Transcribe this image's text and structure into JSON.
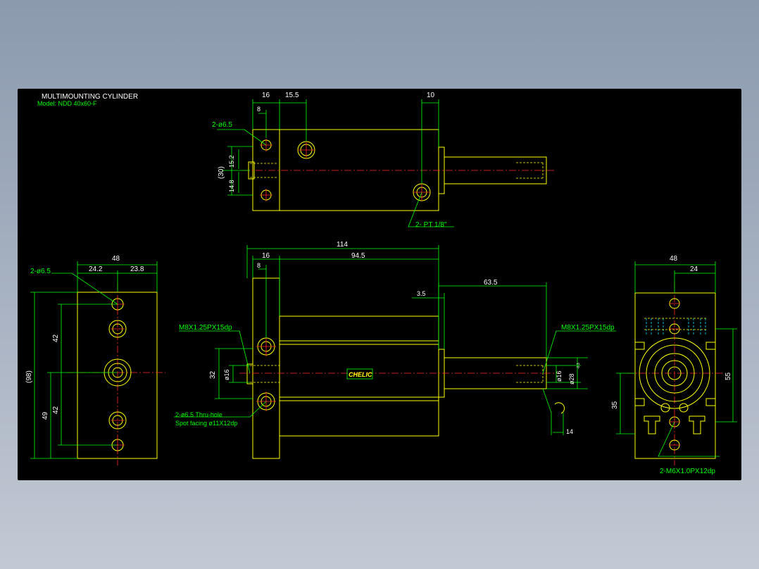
{
  "title": {
    "main": "MULTIMOUNTING CYLINDER",
    "model": "Model: NDD 40x60-F"
  },
  "logo": {
    "text": "CHELIC"
  },
  "colors": {
    "background": "#000000",
    "outline": "#ffff00",
    "dimension": "#00ff00",
    "center": "#ff2a2a",
    "hidden": "#00e5ff"
  },
  "top_view": {
    "dim_16": "16",
    "dim_15_5": "15.5",
    "dim_10": "10",
    "dim_8": "8",
    "holes": "2-ø6.5",
    "dim_15_2": "15.2",
    "dim_30": "(30)",
    "dim_14_8": "14.8",
    "port": "2- PT 1/8\""
  },
  "left_view": {
    "width": "48",
    "half_a": "24.2",
    "half_b": "23.8",
    "holes": "2-ø6.5",
    "height": "(98)",
    "dim_42a": "42",
    "dim_49": "49",
    "dim_42b": "42"
  },
  "front_view": {
    "overall": "114",
    "dim_16": "16",
    "body": "94.5",
    "dim_8": "8",
    "stroke_ext": "63.5",
    "dim_3_5": "3.5",
    "thread_left": "M8X1.25PX15dp",
    "thread_right": "M8X1.25PX15dp",
    "dim_32": "32",
    "dim_16d": "ø16",
    "rod_dia": "ø16",
    "bore": "ø28",
    "bore_tol": "-0.3",
    "thru_hole": "2-ø6.5 Thru-hole",
    "spot_facing": "Spot facing  ø11X12dp",
    "dim_14": "14"
  },
  "right_view": {
    "width": "48",
    "half": "24",
    "height": "55",
    "dim_35": "35",
    "tap": "2-M6X1.0PX12dp"
  }
}
